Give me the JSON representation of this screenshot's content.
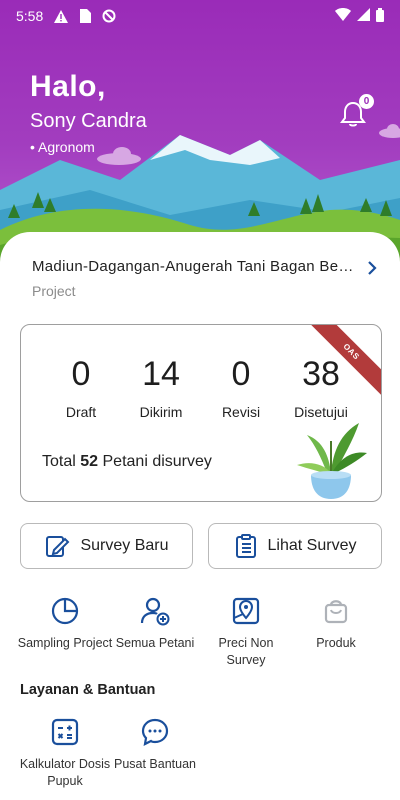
{
  "status_bar": {
    "time": "5:58"
  },
  "header": {
    "greeting": "Halo,",
    "user_name": "Sony Candra",
    "role": "• Agronom",
    "notification_count": "0"
  },
  "project": {
    "name": "Madiun-Dagangan-Anugerah Tani Bagan Besar",
    "label": "Project"
  },
  "summary": {
    "ribbon": "OAS",
    "stats": [
      {
        "value": "0",
        "label": "Draft"
      },
      {
        "value": "14",
        "label": "Dikirim"
      },
      {
        "value": "0",
        "label": "Revisi"
      },
      {
        "value": "38",
        "label": "Disetujui"
      }
    ],
    "total_prefix": "Total",
    "total_value": "52",
    "total_suffix": "Petani disurvey"
  },
  "actions": {
    "survey_baru": "Survey Baru",
    "lihat_survey": "Lihat Survey"
  },
  "menu": [
    {
      "label": "Sampling Project",
      "icon": "pie-chart-icon"
    },
    {
      "label": "Semua Petani",
      "icon": "user-add-icon"
    },
    {
      "label": "Preci Non Survey",
      "icon": "map-pin-icon"
    },
    {
      "label": "Produk",
      "icon": "bag-icon"
    }
  ],
  "support": {
    "title": "Layanan & Bantuan",
    "items": [
      {
        "label": "Kalkulator Dosis Pupuk",
        "icon": "calculator-icon"
      },
      {
        "label": "Pusat Bantuan",
        "icon": "chat-icon"
      }
    ]
  },
  "colors": {
    "brand": "#9a2bb8",
    "accent": "#1a4f9c",
    "ribbon": "#b23b3b"
  }
}
